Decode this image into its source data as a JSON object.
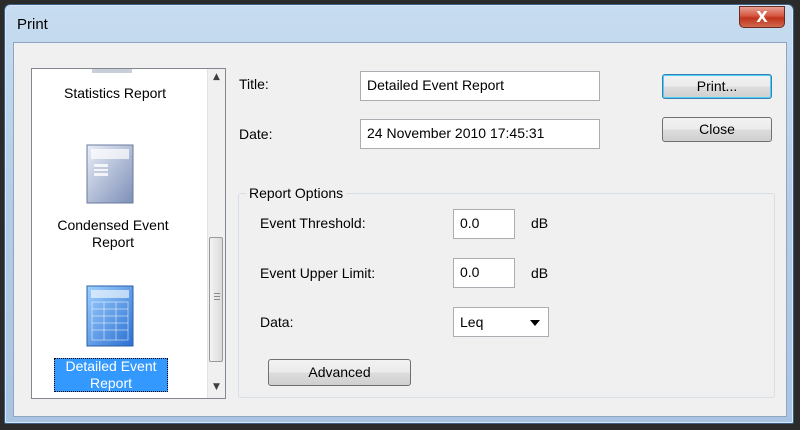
{
  "window": {
    "title": "Print",
    "close_glyph": "X"
  },
  "report_list": {
    "items": [
      {
        "label": "Statistics Report",
        "icon": "document-icon"
      },
      {
        "label": "Condensed Event Report",
        "icon": "condensed-report-icon"
      },
      {
        "label": "Detailed Event Report",
        "icon": "detailed-report-icon",
        "selected": true
      }
    ],
    "scroll_up_glyph": "▲",
    "scroll_down_glyph": "▼"
  },
  "form": {
    "title_label": "Title:",
    "title_value": "Detailed Event Report",
    "date_label": "Date:",
    "date_value": "24 November 2010 17:45:31"
  },
  "buttons": {
    "print": "Print...",
    "close": "Close",
    "advanced": "Advanced"
  },
  "report_options": {
    "group_title": "Report Options",
    "event_threshold_label": "Event Threshold:",
    "event_threshold_value": "0.0",
    "event_threshold_unit": "dB",
    "event_upper_limit_label": "Event Upper Limit:",
    "event_upper_limit_value": "0.0",
    "event_upper_limit_unit": "dB",
    "data_label": "Data:",
    "data_value": "Leq"
  },
  "colors": {
    "selection": "#3399ff",
    "close_button": "#c0331b",
    "title_bar": "#b5cde7"
  }
}
